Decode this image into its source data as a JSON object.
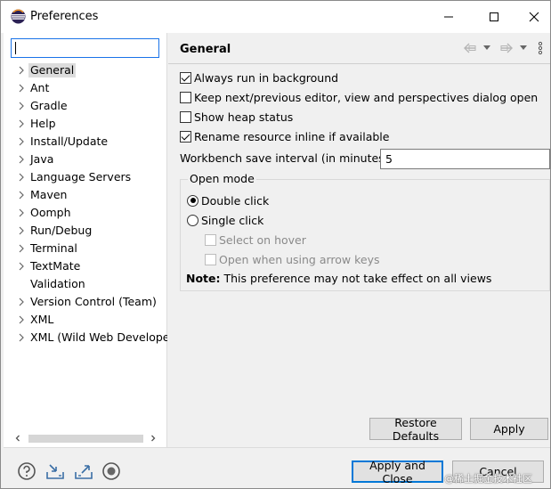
{
  "window": {
    "title": "Preferences",
    "icon": "eclipse-icon"
  },
  "sidebar": {
    "filter_value": "",
    "items": [
      {
        "label": "General",
        "chevron": true,
        "selected": true
      },
      {
        "label": "Ant",
        "chevron": true
      },
      {
        "label": "Gradle",
        "chevron": true
      },
      {
        "label": "Help",
        "chevron": true
      },
      {
        "label": "Install/Update",
        "chevron": true
      },
      {
        "label": "Java",
        "chevron": true
      },
      {
        "label": "Language Servers",
        "chevron": true
      },
      {
        "label": "Maven",
        "chevron": true
      },
      {
        "label": "Oomph",
        "chevron": true
      },
      {
        "label": "Run/Debug",
        "chevron": true
      },
      {
        "label": "Terminal",
        "chevron": true
      },
      {
        "label": "TextMate",
        "chevron": true
      },
      {
        "label": "Validation",
        "chevron": false
      },
      {
        "label": "Version Control (Team)",
        "chevron": true
      },
      {
        "label": "XML",
        "chevron": true
      },
      {
        "label": "XML (Wild Web Developer)",
        "chevron": true
      }
    ]
  },
  "page": {
    "title": "General",
    "options": {
      "always_run_background": {
        "label": "Always run in background",
        "checked": true
      },
      "keep_next_prev": {
        "label": "Keep next/previous editor, view and perspectives dialog open",
        "checked": false
      },
      "show_heap": {
        "label": "Show heap status",
        "checked": false
      },
      "rename_inline": {
        "label": "Rename resource inline if available",
        "checked": true
      }
    },
    "save_interval": {
      "label": "Workbench save interval (in minutes):",
      "value": "5"
    },
    "open_mode": {
      "title": "Open mode",
      "double_click": {
        "label": "Double click",
        "selected": true
      },
      "single_click": {
        "label": "Single click",
        "selected": false
      },
      "select_on_hover": {
        "label": "Select on hover",
        "checked": false,
        "enabled": false
      },
      "open_arrow_keys": {
        "label": "Open when using arrow keys",
        "checked": false,
        "enabled": false
      }
    },
    "note": {
      "prefix": "Note:",
      "text": " This preference may not take effect on all views"
    }
  },
  "buttons": {
    "restore_defaults": "Restore Defaults",
    "apply": "Apply",
    "apply_and_close": "Apply and Close",
    "cancel": "Cancel"
  },
  "watermark": "@稀土掘金技术社区",
  "colors": {
    "accent": "#0078d7",
    "selection": "#dcdcdc",
    "panel": "#f0f0f0"
  }
}
